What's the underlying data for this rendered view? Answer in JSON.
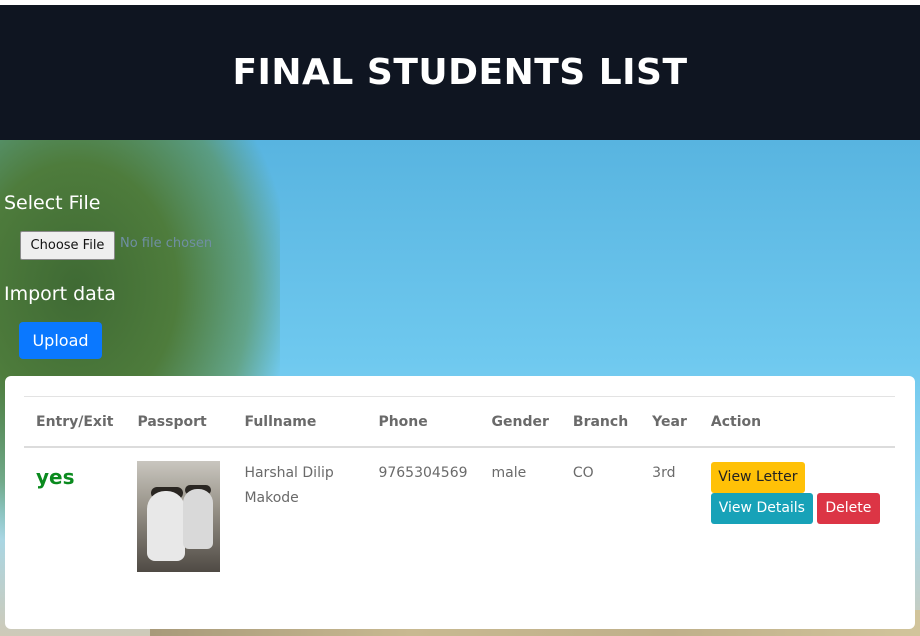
{
  "header": {
    "title": "FINAL STUDENTS LIST"
  },
  "upload_form": {
    "select_file_label": "Select File",
    "choose_file_button": "Choose File",
    "file_status": "No file chosen",
    "import_label": "Import data",
    "upload_button": "Upload"
  },
  "table": {
    "columns": [
      "Entry/Exit",
      "Passport",
      "Fullname",
      "Phone",
      "Gender",
      "Branch",
      "Year",
      "Action"
    ],
    "rows": [
      {
        "entry_exit": "yes",
        "passport_image": "student-photo",
        "fullname": "Harshal Dilip Makode",
        "phone": "9765304569",
        "gender": "male",
        "branch": "CO",
        "year": "3rd",
        "actions": {
          "view_letter": "View Letter",
          "view_details": "View Details",
          "delete": "Delete"
        }
      }
    ]
  },
  "colors": {
    "header_bg": "#0f1521",
    "upload_button": "#0a78ff",
    "entry_yes": "#0a8a1e",
    "view_letter": "#ffc107",
    "view_details": "#17a2b8",
    "delete": "#dc3545"
  }
}
